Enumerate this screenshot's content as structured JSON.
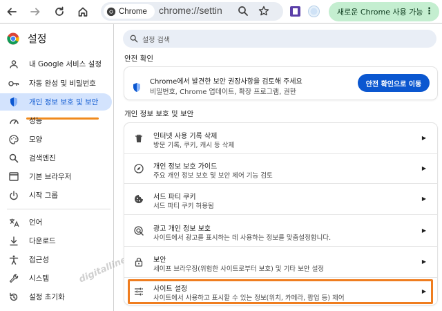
{
  "toolbar": {
    "chip_label": "Chrome",
    "url": "chrome://settin",
    "update_label": "새로운 Chrome 사용 가능",
    "kebab": "⋮"
  },
  "sidebar": {
    "title": "설정",
    "items": [
      {
        "label": "내 Google 서비스 설정",
        "icon": "person-icon"
      },
      {
        "label": "자동 완성 및 비밀번호",
        "icon": "key-icon"
      },
      {
        "label": "개인 정보 보호 및 보안",
        "icon": "shield-icon",
        "active": true
      },
      {
        "label": "성능",
        "icon": "speedometer-icon"
      },
      {
        "label": "모양",
        "icon": "palette-icon"
      },
      {
        "label": "검색엔진",
        "icon": "search-icon"
      },
      {
        "label": "기본 브라우저",
        "icon": "browser-icon"
      },
      {
        "label": "시작 그룹",
        "icon": "power-icon"
      },
      {
        "label": "언어",
        "icon": "translate-icon"
      },
      {
        "label": "다운로드",
        "icon": "download-icon"
      },
      {
        "label": "접근성",
        "icon": "accessibility-icon"
      },
      {
        "label": "시스템",
        "icon": "wrench-icon"
      },
      {
        "label": "설정 초기화",
        "icon": "restore-icon"
      }
    ]
  },
  "search": {
    "placeholder": "설정 검색"
  },
  "safety_check": {
    "section_title": "안전 확인",
    "line1": "Chrome에서 발견한 보안 권장사항을 검토해 주세요",
    "line2": "비밀번호, Chrome 업데이트, 확장 프로그램, 권한",
    "button": "안전 확인으로 이동"
  },
  "privacy": {
    "section_title": "개인 정보 보호 및 보안",
    "rows": [
      {
        "title": "인터넷 사용 기록 삭제",
        "sub": "방문 기록, 쿠키, 캐시 등 삭제",
        "icon": "trash-icon"
      },
      {
        "title": "개인 정보 보호 가이드",
        "sub": "주요 개인 정보 보호 및 보안 제어 기능 검토",
        "icon": "compass-icon"
      },
      {
        "title": "서드 파티 쿠키",
        "sub": "서드 파티 쿠키 허용됨",
        "icon": "cookie-icon"
      },
      {
        "title": "광고 개인 정보 보호",
        "sub": "사이트에서 광고를 표시하는 데 사용하는 정보를 맞춤설정합니다.",
        "icon": "ad-privacy-icon"
      },
      {
        "title": "보안",
        "sub": "세이프 브라우징(위험한 사이트로부터 보호) 및 기타 보안 설정",
        "icon": "lock-icon"
      },
      {
        "title": "사이트 설정",
        "sub": "사이트에서 사용하고 표시할 수 있는 정보(위치, 카메라, 팝업 등) 제어",
        "icon": "sliders-icon"
      }
    ]
  },
  "watermark": "digitalline",
  "colors": {
    "accent": "#0b57d0",
    "active_bg": "#d3e3fd",
    "highlight": "#ef7d1f",
    "update_bg": "#c4eed0"
  }
}
